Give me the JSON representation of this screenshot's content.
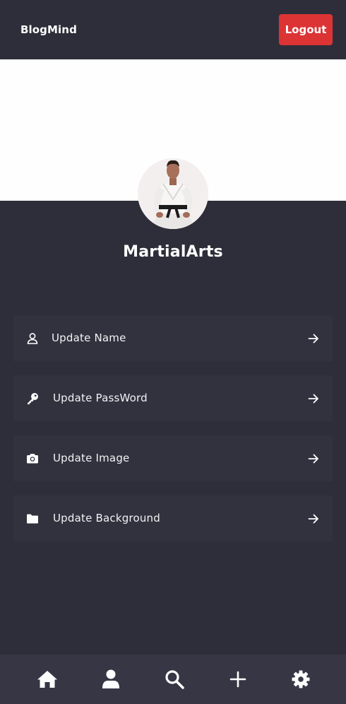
{
  "header": {
    "brand": "BlogMind",
    "logout_label": "Logout"
  },
  "profile": {
    "username": "MartialArts",
    "avatar_icon": "martial-artist-photo"
  },
  "menu": [
    {
      "label": "Update Name",
      "icon": "user-icon"
    },
    {
      "label": "Update PassWord",
      "icon": "key-icon"
    },
    {
      "label": "Update Image",
      "icon": "camera-icon"
    },
    {
      "label": "Update Background",
      "icon": "folder-icon"
    }
  ],
  "bottom_nav": [
    {
      "icon": "home-icon"
    },
    {
      "icon": "user-icon"
    },
    {
      "icon": "search-icon"
    },
    {
      "icon": "plus-icon"
    },
    {
      "icon": "gear-icon"
    }
  ],
  "colors": {
    "background": "#2e2e3a",
    "card": "#32323f",
    "nav": "#363645",
    "accent_red": "#dc3435",
    "cover": "#fefefe"
  }
}
